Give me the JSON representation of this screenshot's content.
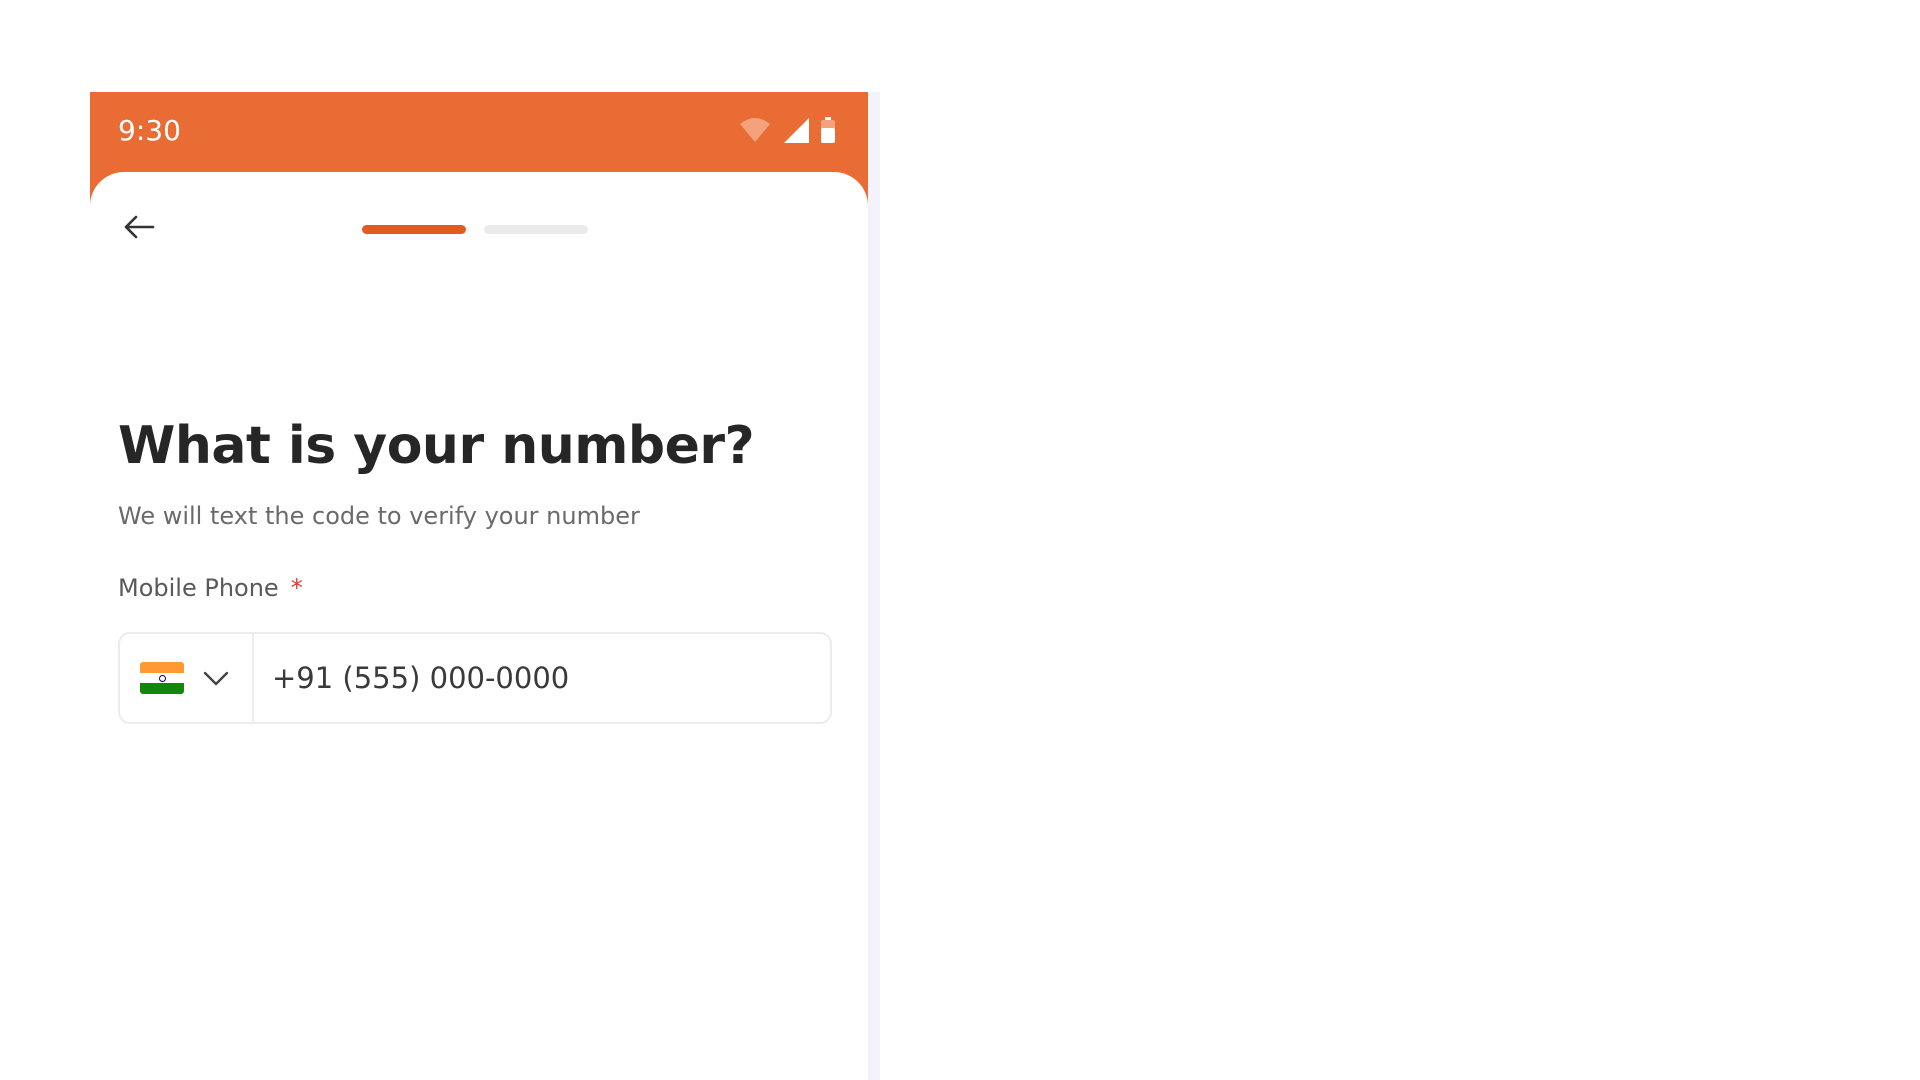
{
  "status_bar": {
    "time": "9:30",
    "icons": [
      "wifi-icon",
      "signal-icon",
      "battery-icon"
    ]
  },
  "nav": {
    "back_icon": "arrow-left-icon",
    "progress": {
      "total_steps": 2,
      "current_step": 1
    }
  },
  "content": {
    "title": "What is your number?",
    "subtitle": "We will text the code to verify your number",
    "field_label": "Mobile Phone",
    "required_mark": "*",
    "country": {
      "flag": "india-flag-icon",
      "dropdown_icon": "chevron-down-icon"
    },
    "phone_placeholder": "+91 (555) 000-0000",
    "phone_value": ""
  },
  "colors": {
    "brand": "#e96c35",
    "progress_active": "#e55a22",
    "progress_inactive": "#ebebeb",
    "required": "#e53935",
    "title": "#262626"
  }
}
